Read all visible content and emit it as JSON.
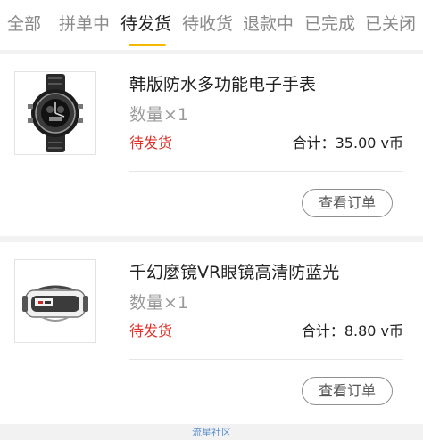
{
  "tabs": [
    "全部",
    "拼单中",
    "待发货",
    "待收货",
    "退款中",
    "已完成",
    "已关闭"
  ],
  "active_tab": "待发货",
  "orders": [
    {
      "title": "韩版防水多功能电子手表",
      "quantity": "数量×1",
      "status": "待发货",
      "total": "合计：35.00 v币",
      "button": "查看订单",
      "image": "sport-watch-image"
    },
    {
      "title": "千幻麼镜VR眼镜高清防蓝光",
      "quantity": "数量×1",
      "status": "待发货",
      "total": "合计：8.80 v币",
      "button": "查看订单",
      "image": "vr-headset-image"
    }
  ],
  "footer_text": "流星社区",
  "colors": {
    "accent": "#f5b800",
    "status": "#e0322a",
    "footer_link": "#5a8fcf"
  }
}
